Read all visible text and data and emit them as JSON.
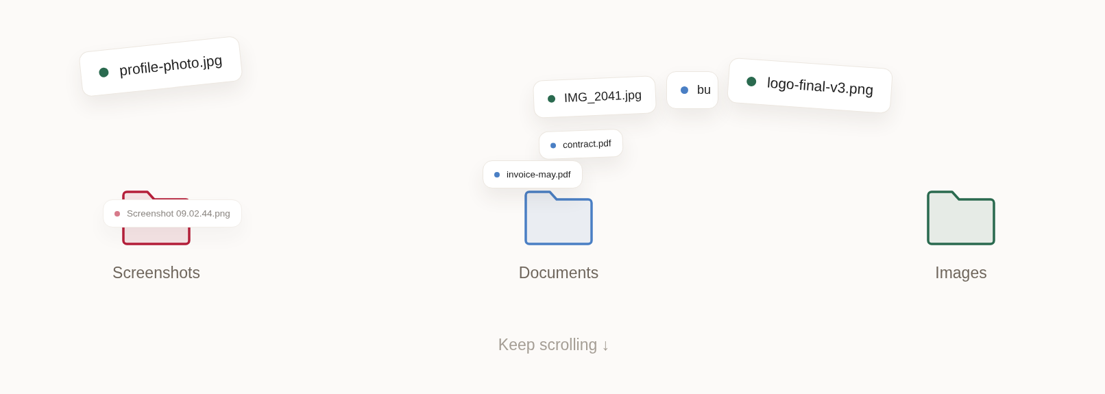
{
  "chips": [
    {
      "name": "profile-photo.jpg",
      "color": "#2a6a4f",
      "kind": "large",
      "faded": false
    },
    {
      "name": "IMG_2041.jpg",
      "color": "#2a6a4f",
      "kind": "medium",
      "faded": false
    },
    {
      "name": "bu",
      "color": "#4a7fc4",
      "kind": "medium",
      "faded": false
    },
    {
      "name": "logo-final-v3.png",
      "color": "#2a6a4f",
      "kind": "large",
      "faded": false
    },
    {
      "name": "contract.pdf",
      "color": "#4a7fc4",
      "kind": "small",
      "faded": false
    },
    {
      "name": "invoice-may.pdf",
      "color": "#4a7fc4",
      "kind": "small",
      "faded": false
    },
    {
      "name": "Screenshot 09.02.44.png",
      "color": "#d77a8a",
      "kind": "small",
      "faded": true
    }
  ],
  "folders": [
    {
      "label": "Screenshots",
      "color": "#b51f3a"
    },
    {
      "label": "Documents",
      "color": "#4a7fc4"
    },
    {
      "label": "Images",
      "color": "#2a6a4f"
    }
  ],
  "hint": "Keep scrolling ↓"
}
